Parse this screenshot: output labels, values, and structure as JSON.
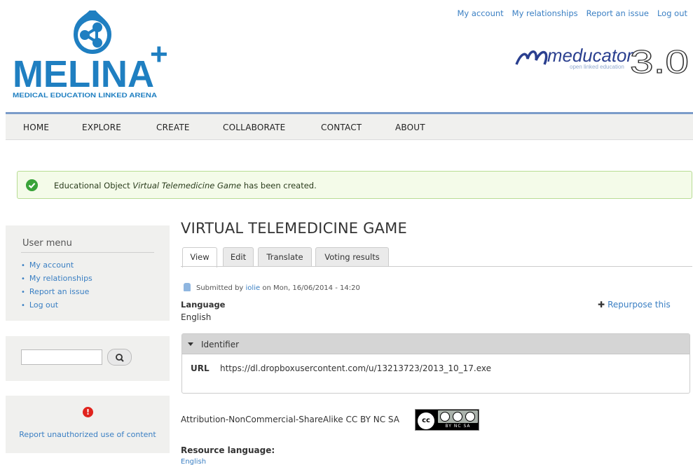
{
  "top_links": [
    "My account",
    "My relationships",
    "Report an issue",
    "Log out"
  ],
  "logo": {
    "name": "MELINA",
    "plus": "+",
    "tagline": "MEDICAL EDUCATION LINKED ARENA"
  },
  "partner_logo": {
    "name": "meducator",
    "version": "3.0",
    "tagline": "open linked education"
  },
  "nav": [
    "HOME",
    "EXPLORE",
    "CREATE",
    "COLLABORATE",
    "CONTACT",
    "ABOUT"
  ],
  "status": {
    "prefix": "Educational Object ",
    "title": "Virtual Telemedicine Game",
    "suffix": " has been created."
  },
  "sidebar": {
    "user_menu": {
      "title": "User menu",
      "items": [
        "My account",
        "My relationships",
        "Report an issue",
        "Log out"
      ]
    },
    "search": {
      "placeholder": "",
      "button_icon": "search-icon"
    },
    "report": {
      "icon": "warning-icon",
      "link": "Report unauthorized use of content"
    }
  },
  "content": {
    "title": "VIRTUAL TELEMEDICINE GAME",
    "tabs": [
      "View",
      "Edit",
      "Translate",
      "Voting results"
    ],
    "active_tab": "View",
    "submitted": {
      "prefix": "Submitted by ",
      "user": "iolie",
      "suffix": " on Mon, 16/06/2014 - 14:20"
    },
    "language": {
      "label": "Language",
      "value": "English"
    },
    "repurpose": "Repurpose this",
    "identifier": {
      "legend": "Identifier",
      "url_label": "URL",
      "url_value": "https://dl.dropboxusercontent.com/u/13213723/2013_10_17.exe"
    },
    "license": "Attribution-NonCommercial-ShareAlike CC BY NC SA",
    "cc_badge": {
      "mark": "cc",
      "codes": "BY NC SA"
    },
    "resource_language": {
      "label": "Resource language:",
      "value": "English"
    }
  },
  "colors": {
    "link": "#3a7fc3",
    "logo_blue": "#1f7fc1",
    "nav_rule": "#7b9cc9",
    "status_bg": "#f4fbe9",
    "status_border": "#b8dc94",
    "status_check": "#3aa33a",
    "warning": "#e0231d"
  }
}
